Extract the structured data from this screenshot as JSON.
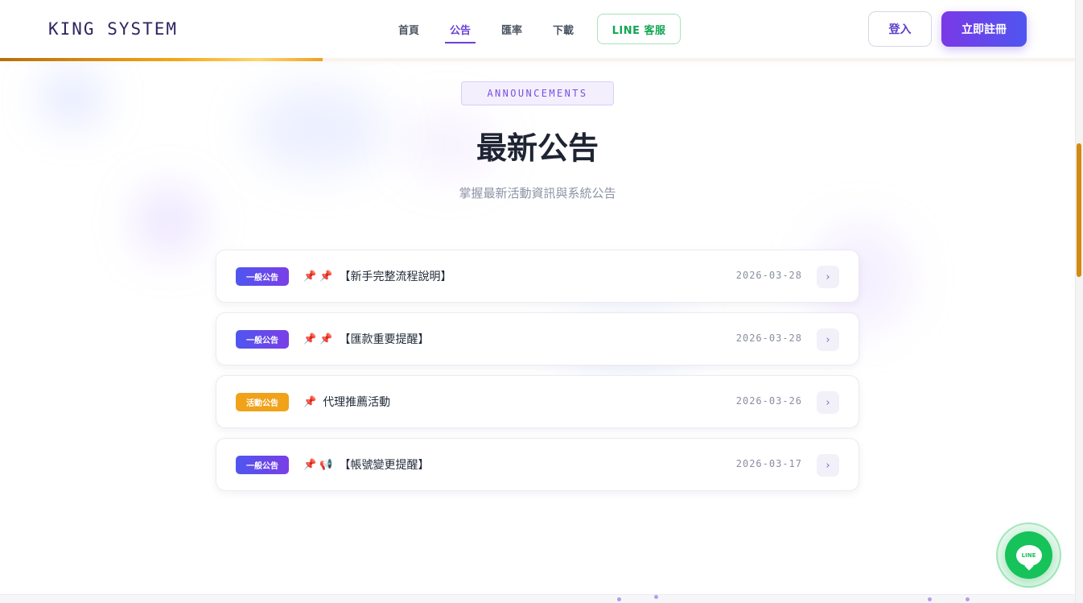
{
  "header": {
    "logo": "KING SYSTEM",
    "nav": [
      {
        "label": "首頁",
        "active": false
      },
      {
        "label": "公告",
        "active": true
      },
      {
        "label": "匯率",
        "active": false
      },
      {
        "label": "下載",
        "active": false
      }
    ],
    "line_button": "LINE 客服",
    "login": "登入",
    "register": "立即註冊",
    "scroll_progress": 0.3
  },
  "section": {
    "eyebrow": "ANNOUNCEMENTS",
    "title": "最新公告",
    "subtitle": "掌握最新活動資訊與系統公告"
  },
  "announcements": [
    {
      "badge": "一般公告",
      "type": "general",
      "icons": "📌 📌",
      "title": "【新手完整流程說明】",
      "date": "2026-03-28",
      "arrow": "›"
    },
    {
      "badge": "一般公告",
      "type": "general",
      "icons": "📌 📌",
      "title": "【匯款重要提醒】",
      "date": "2026-03-28",
      "arrow": "›"
    },
    {
      "badge": "活動公告",
      "type": "event",
      "icons": "📌",
      "title": "代理推薦活動",
      "date": "2026-03-26",
      "arrow": "›"
    },
    {
      "badge": "一般公告",
      "type": "general",
      "icons": "📌 📢",
      "title": "【帳號變更提醒】",
      "date": "2026-03-17",
      "arrow": "›"
    }
  ],
  "floating": {
    "label": "LINE"
  },
  "colors": {
    "accent": "#6d3fd8",
    "brand_gradient_start": "#7a39e6",
    "brand_gradient_end": "#4f56f0",
    "line_green": "#16c25a",
    "event_badge": "#f0a21a",
    "progress": "#f3a818"
  }
}
